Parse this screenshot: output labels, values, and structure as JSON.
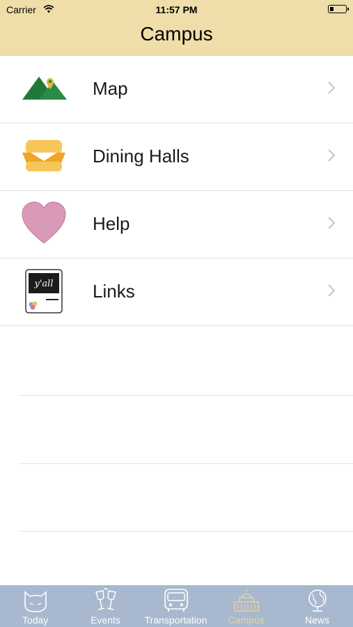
{
  "status_bar": {
    "carrier": "Carrier",
    "time": "11:57 PM"
  },
  "nav": {
    "title": "Campus"
  },
  "rows": [
    {
      "label": "Map",
      "icon": "mountain-map-pin-icon"
    },
    {
      "label": "Dining Halls",
      "icon": "sandwich-icon"
    },
    {
      "label": "Help",
      "icon": "heart-icon"
    },
    {
      "label": "Links",
      "icon": "yall-card-icon",
      "icon_text": "y'all"
    }
  ],
  "tabs": [
    {
      "label": "Today",
      "icon": "cat-face-icon",
      "active": false
    },
    {
      "label": "Events",
      "icon": "champagne-glasses-icon",
      "active": false
    },
    {
      "label": "Transportation",
      "icon": "bus-icon",
      "active": false
    },
    {
      "label": "Campus",
      "icon": "capitol-building-icon",
      "active": true
    },
    {
      "label": "News",
      "icon": "globe-icon",
      "active": false
    }
  ],
  "colors": {
    "header_bg": "#efdeaa",
    "tabbar_bg": "#a8b8cf",
    "tab_active": "#e6d59a",
    "tab_inactive": "#ffffff",
    "map_green": "#1f7a3a",
    "sandwich_orange": "#f2b43b",
    "heart_pink": "#d89ab8"
  }
}
